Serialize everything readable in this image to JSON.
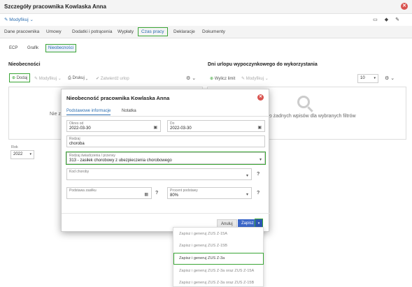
{
  "window": {
    "title": "Szczegóły pracownika Kowlaska Anna",
    "close_glyph": "✕"
  },
  "toolbar": {
    "modify_label": "Modyfikuj",
    "caret": "⌄",
    "icons": [
      "folder-icon",
      "tag-icon",
      "pencil-icon"
    ],
    "icon_glyphs": [
      "▭",
      "◆",
      "✎"
    ]
  },
  "tabs": [
    "Dane pracownika",
    "Umowy",
    "Dodatki i potrącenia",
    "Wypłaty",
    "Czas pracy",
    "Deklaracje",
    "Dokumenty"
  ],
  "active_tab": "Czas pracy",
  "subtabs": [
    "ECP",
    "Grafik",
    "Nieobecności"
  ],
  "active_subtab": "Nieobecności",
  "left": {
    "heading": "Nieobecności",
    "add_label": "Dodaj",
    "modify_label": "Modyfikuj",
    "print_label": "Drukuj",
    "approve_label": "Zatwierdź urlop",
    "empty_text_partial": "Nie z",
    "year_label": "Rok",
    "year_value": "2022"
  },
  "right": {
    "heading": "Dni urlopu wypoczynkowego do wykorzystania",
    "calc_label": "Wylicz limit",
    "modify_label": "Modyfikuj",
    "page_size": "10",
    "empty_text": "ziono żadnych wpisów dla wybranych filtrów"
  },
  "modal": {
    "title": "Nieobecność pracownika Kowlaska Anna",
    "tabs": [
      "Podstawowe informacje",
      "Notatka"
    ],
    "fields": {
      "from_label": "Okres od",
      "from_value": "2022-03-30",
      "to_label": "Do",
      "to_value": "2022-03-30",
      "type_label": "Rodzaj",
      "type_value": "choroba",
      "benefit_label": "Rodzaj świadczenia / przerwy",
      "benefit_value": "313 - zasiłek chorobowy z ubezpieczenia chorobowego",
      "disease_label": "Kod choroby",
      "disease_value": "",
      "base_label": "Podstawa zasiłku",
      "base_value": "",
      "percent_label": "Procent podstawy",
      "percent_value": "80%"
    },
    "cancel_label": "Anuluj",
    "save_label": "Zapisz",
    "help_glyph": "?"
  },
  "save_menu": [
    "Zapisz i generuj ZUS Z-15A",
    "Zapisz i generuj ZUS Z-15B",
    "Zapisz i generuj ZUS Z-3a",
    "Zapisz i generuj ZUS Z-3a oraz ZUS Z-15A",
    "Zapisz i generuj ZUS Z-3a oraz ZUS Z-15B"
  ],
  "colors": {
    "accent": "#2a6db0",
    "highlight": "#3aa535",
    "danger": "#d9534f",
    "primary_button": "#3d68c9"
  }
}
